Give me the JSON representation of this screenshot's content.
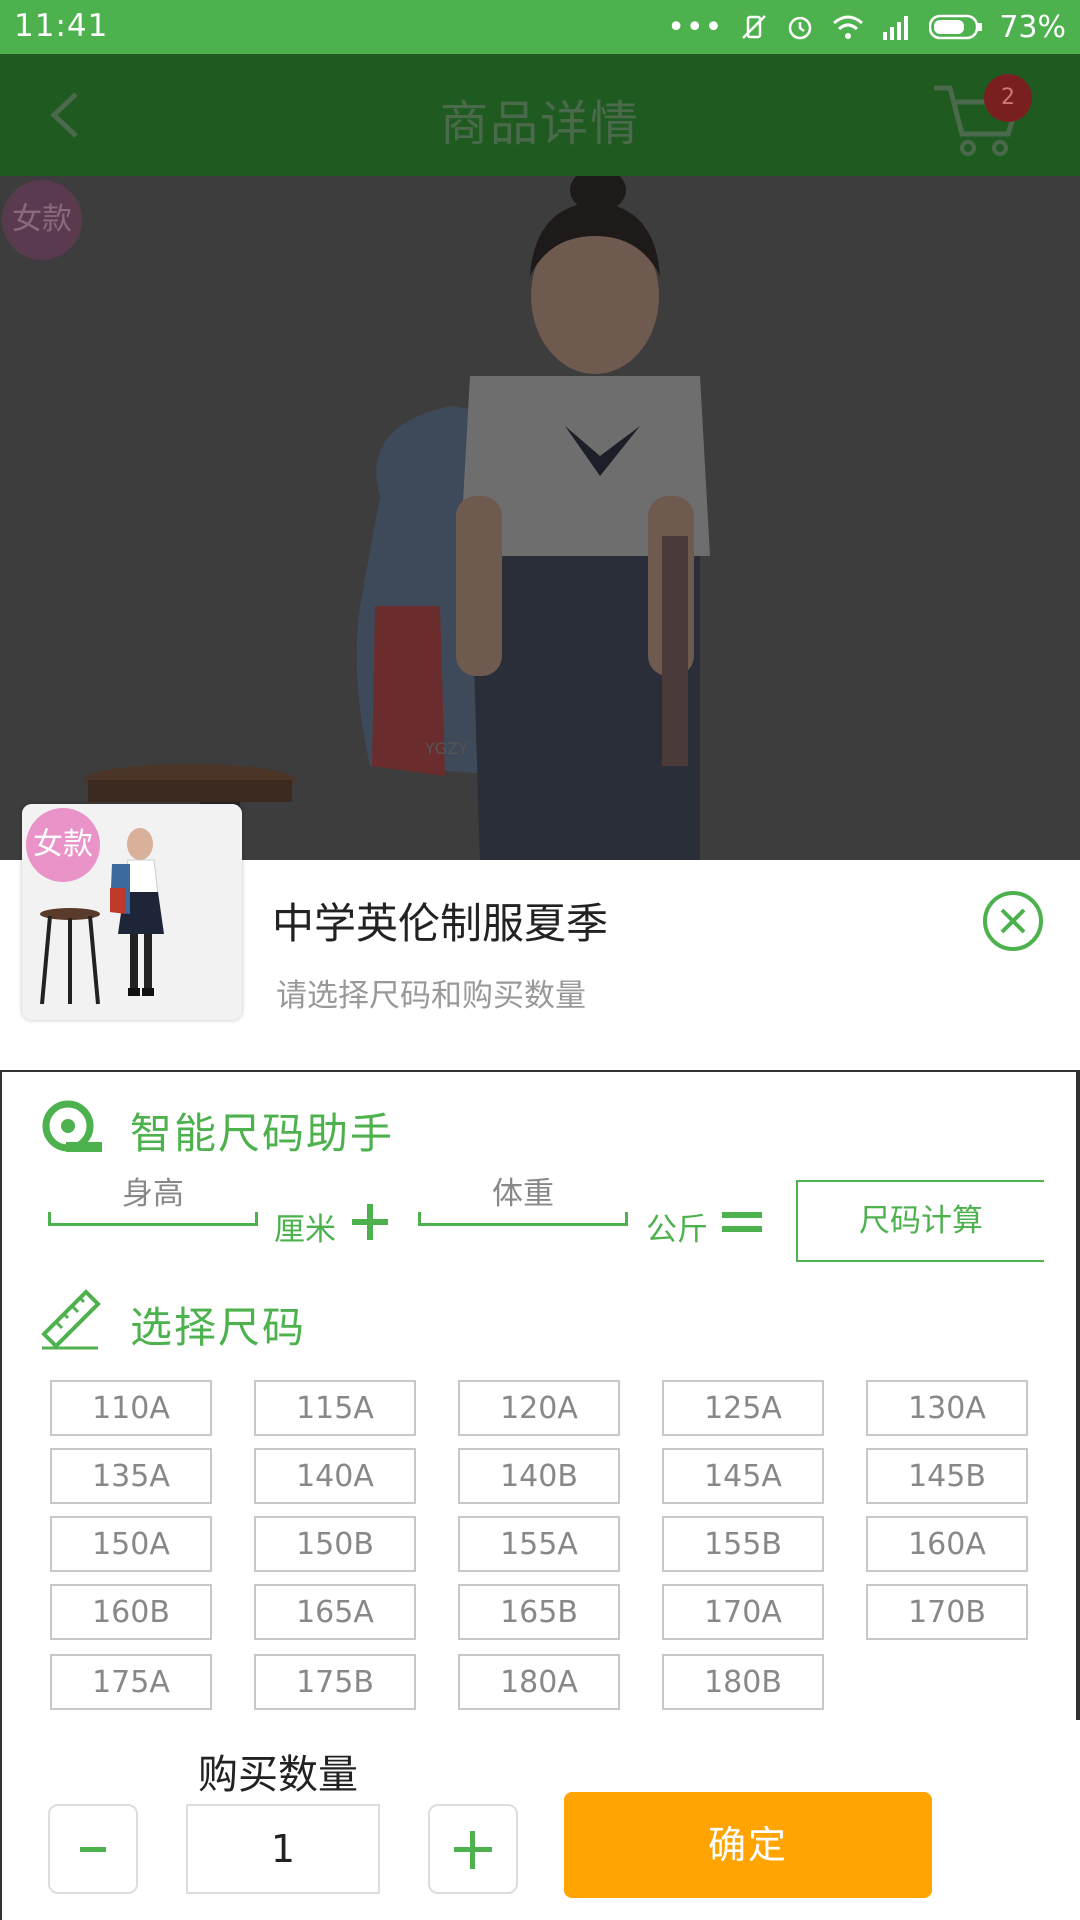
{
  "status_bar": {
    "time": "11:41",
    "battery": "73%"
  },
  "header": {
    "title": "商品详情",
    "cart_count": "2"
  },
  "hero": {
    "tag": "女款",
    "watermark": "YGZY"
  },
  "product": {
    "tag": "女款",
    "name": "中学英伦制服夏季",
    "hint": "请选择尺码和购买数量"
  },
  "size_helper": {
    "title": "智能尺码助手",
    "height_placeholder": "身高",
    "height_unit": "厘米",
    "weight_placeholder": "体重",
    "weight_unit": "公斤",
    "calc_label": "尺码计算"
  },
  "size_select": {
    "title": "选择尺码",
    "sizes": [
      "110A",
      "115A",
      "120A",
      "125A",
      "130A",
      "135A",
      "140A",
      "140B",
      "145A",
      "145B",
      "150A",
      "150B",
      "155A",
      "155B",
      "160A",
      "160B",
      "165A",
      "165B",
      "170A",
      "170B",
      "175A",
      "175B",
      "180A",
      "180B"
    ]
  },
  "quantity": {
    "label": "购买数量",
    "value": "1",
    "minus": "-",
    "plus": "+"
  },
  "confirm_label": "确定",
  "colors": {
    "accent": "#4db14e",
    "confirm": "#ffa400"
  }
}
